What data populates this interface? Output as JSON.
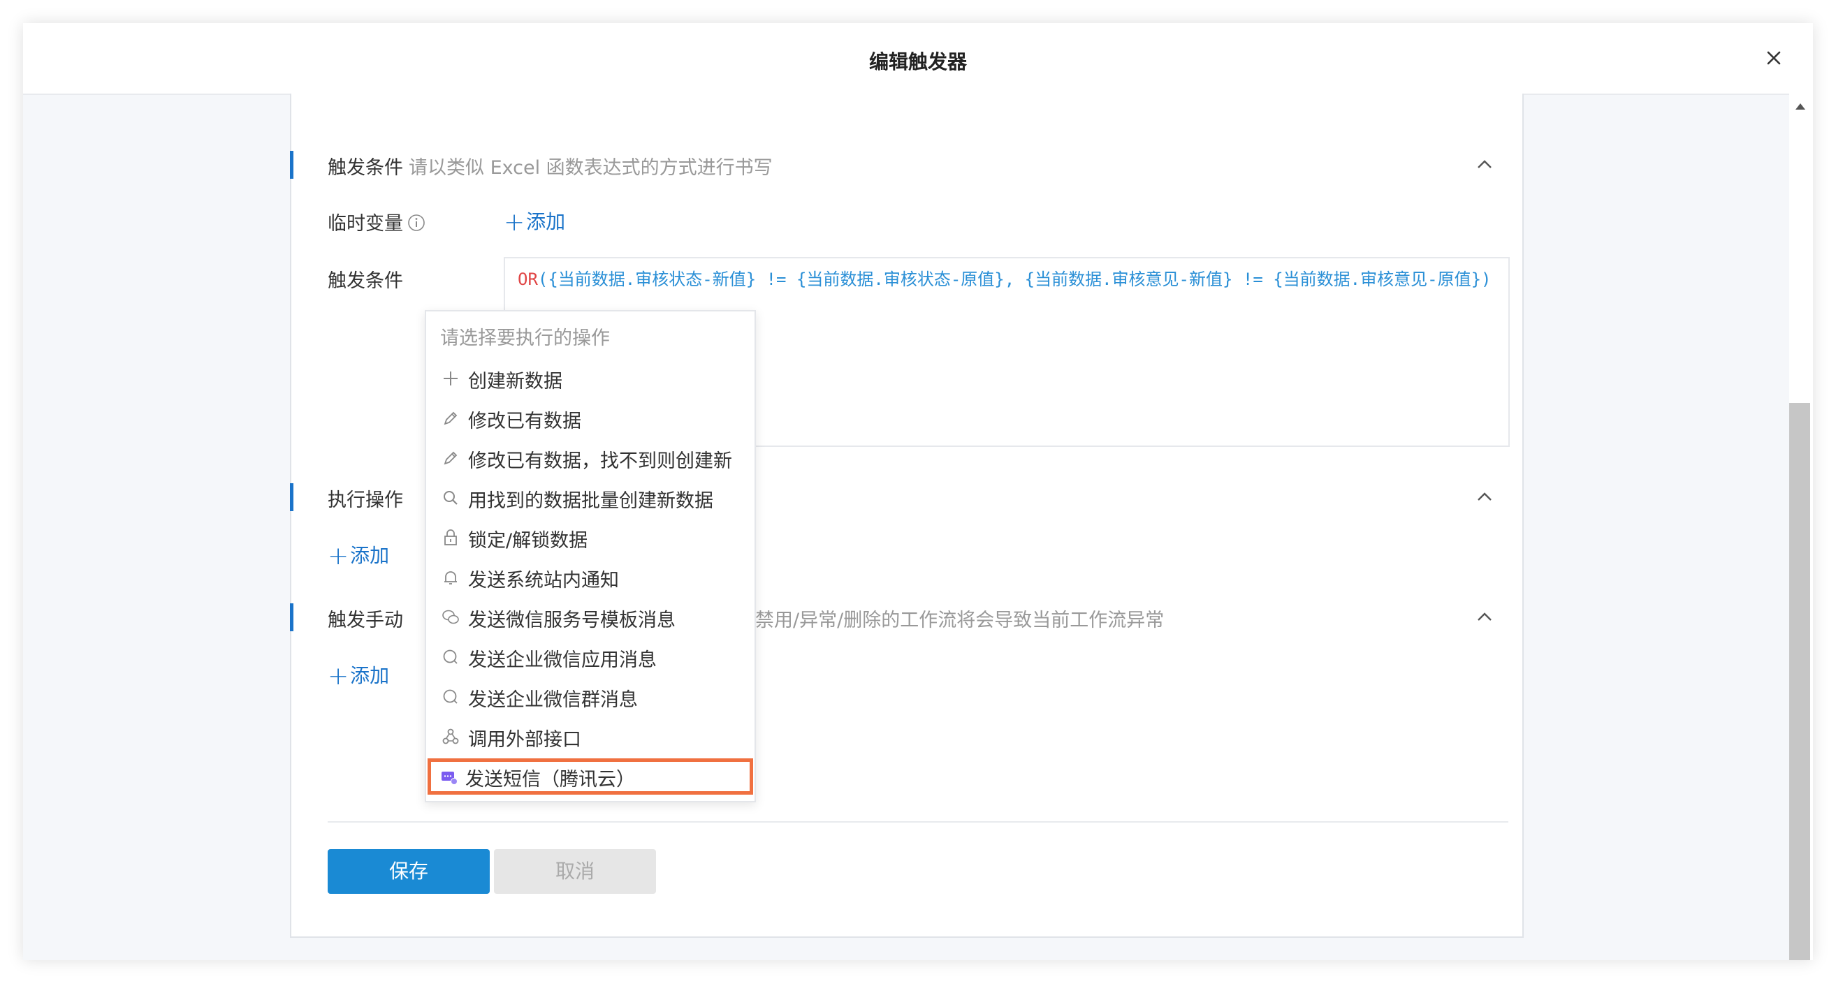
{
  "dialog": {
    "title": "编辑触发器"
  },
  "section_condition": {
    "title": "触发条件",
    "hint": "请以类似 Excel 函数表达式的方式进行书写",
    "temp_var_label": "临时变量",
    "add_label": "添加",
    "condition_label": "触发条件",
    "expression_keyword": "OR",
    "expression_rest": "({当前数据.审核状态-新值} != {当前数据.审核状态-原值}, {当前数据.审核意见-新值} != {当前数据.审核意见-原值})"
  },
  "section_action": {
    "title": "执行操作",
    "add_label": "添加"
  },
  "section_manual": {
    "title": "触发手动",
    "hint_visible": "禁用/异常/删除的工作流将会导致当前工作流异常",
    "add_label": "添加"
  },
  "dropdown": {
    "header": "请选择要执行的操作",
    "items": [
      {
        "label": "创建新数据",
        "icon": "plus-icon"
      },
      {
        "label": "修改已有数据",
        "icon": "pencil-icon"
      },
      {
        "label": "修改已有数据，找不到则创建新",
        "icon": "pencil-icon"
      },
      {
        "label": "用找到的数据批量创建新数据",
        "icon": "search-icon"
      },
      {
        "label": "锁定/解锁数据",
        "icon": "lock-icon"
      },
      {
        "label": "发送系统站内通知",
        "icon": "bell-icon"
      },
      {
        "label": "发送微信服务号模板消息",
        "icon": "wechat-icon"
      },
      {
        "label": "发送企业微信应用消息",
        "icon": "chat-icon"
      },
      {
        "label": "发送企业微信群消息",
        "icon": "chat-icon"
      },
      {
        "label": "调用外部接口",
        "icon": "webhook-icon"
      },
      {
        "label": "发送短信（腾讯云）",
        "icon": "sms-icon",
        "highlighted": true
      }
    ]
  },
  "footer": {
    "save_label": "保存",
    "cancel_label": "取消"
  },
  "colors": {
    "accent": "#1a73c9",
    "highlight": "#f07040",
    "keyword": "#e04545"
  }
}
